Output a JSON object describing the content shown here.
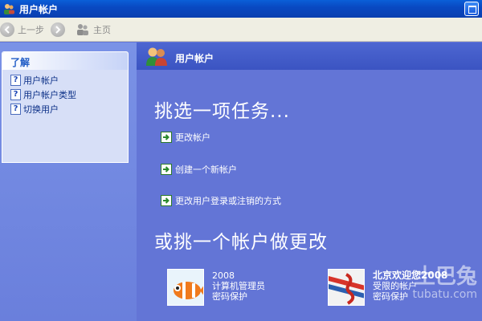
{
  "window": {
    "title": "用户帐户"
  },
  "toolbar": {
    "back_label": "上一步",
    "home_label": "主页"
  },
  "sidebar": {
    "heading": "了解",
    "items": [
      {
        "label": "用户帐户"
      },
      {
        "label": "用户帐户类型"
      },
      {
        "label": "切换用户"
      }
    ]
  },
  "main": {
    "header_label": "用户帐户",
    "pick_task_title": "挑选一项任务...",
    "tasks": [
      {
        "label": "更改帐户"
      },
      {
        "label": "创建一个新帐户"
      },
      {
        "label": "更改用户登录或注销的方式"
      }
    ],
    "pick_account_title": "或挑一个帐户做更改",
    "accounts": [
      {
        "name": "2008",
        "type": "计算机管理员",
        "status": "密码保护"
      },
      {
        "name": "北京欢迎您2008",
        "type": "受限的帐户",
        "status": "密码保护"
      }
    ]
  },
  "watermark": {
    "brand": "土巴兔",
    "url": "tubatu.com"
  },
  "colors": {
    "main_bg": "#6375d6",
    "title_bar": "#0a4fc8",
    "task_arrow": "#2b8a2b"
  }
}
